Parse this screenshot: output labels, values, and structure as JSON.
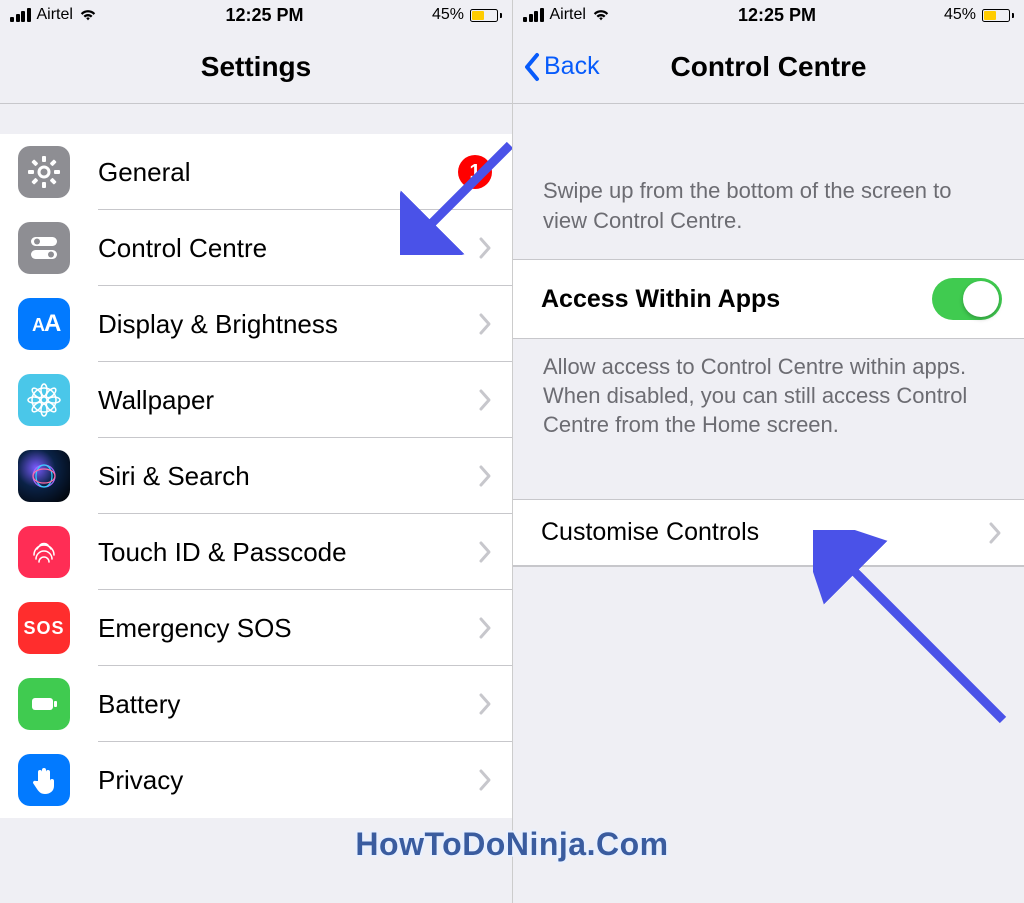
{
  "statusbar": {
    "carrier": "Airtel",
    "time": "12:25 PM",
    "battery_pct": "45%"
  },
  "left": {
    "title": "Settings",
    "rows": {
      "general": {
        "label": "General",
        "badge": "1"
      },
      "control_centre": {
        "label": "Control Centre"
      },
      "display": {
        "label": "Display & Brightness"
      },
      "wallpaper": {
        "label": "Wallpaper"
      },
      "siri": {
        "label": "Siri & Search"
      },
      "touchid": {
        "label": "Touch ID & Passcode"
      },
      "sos": {
        "label": "Emergency SOS"
      },
      "battery": {
        "label": "Battery"
      },
      "privacy": {
        "label": "Privacy"
      }
    }
  },
  "right": {
    "back": "Back",
    "title": "Control Centre",
    "intro": "Swipe up from the bottom of the screen to view Control Centre.",
    "access_label": "Access Within Apps",
    "access_footer": "Allow access to Control Centre within apps. When disabled, you can still access Control Centre from the Home screen.",
    "customise": "Customise Controls"
  },
  "sos_text": "SOS",
  "watermark": "HowToDoNinja.Com"
}
